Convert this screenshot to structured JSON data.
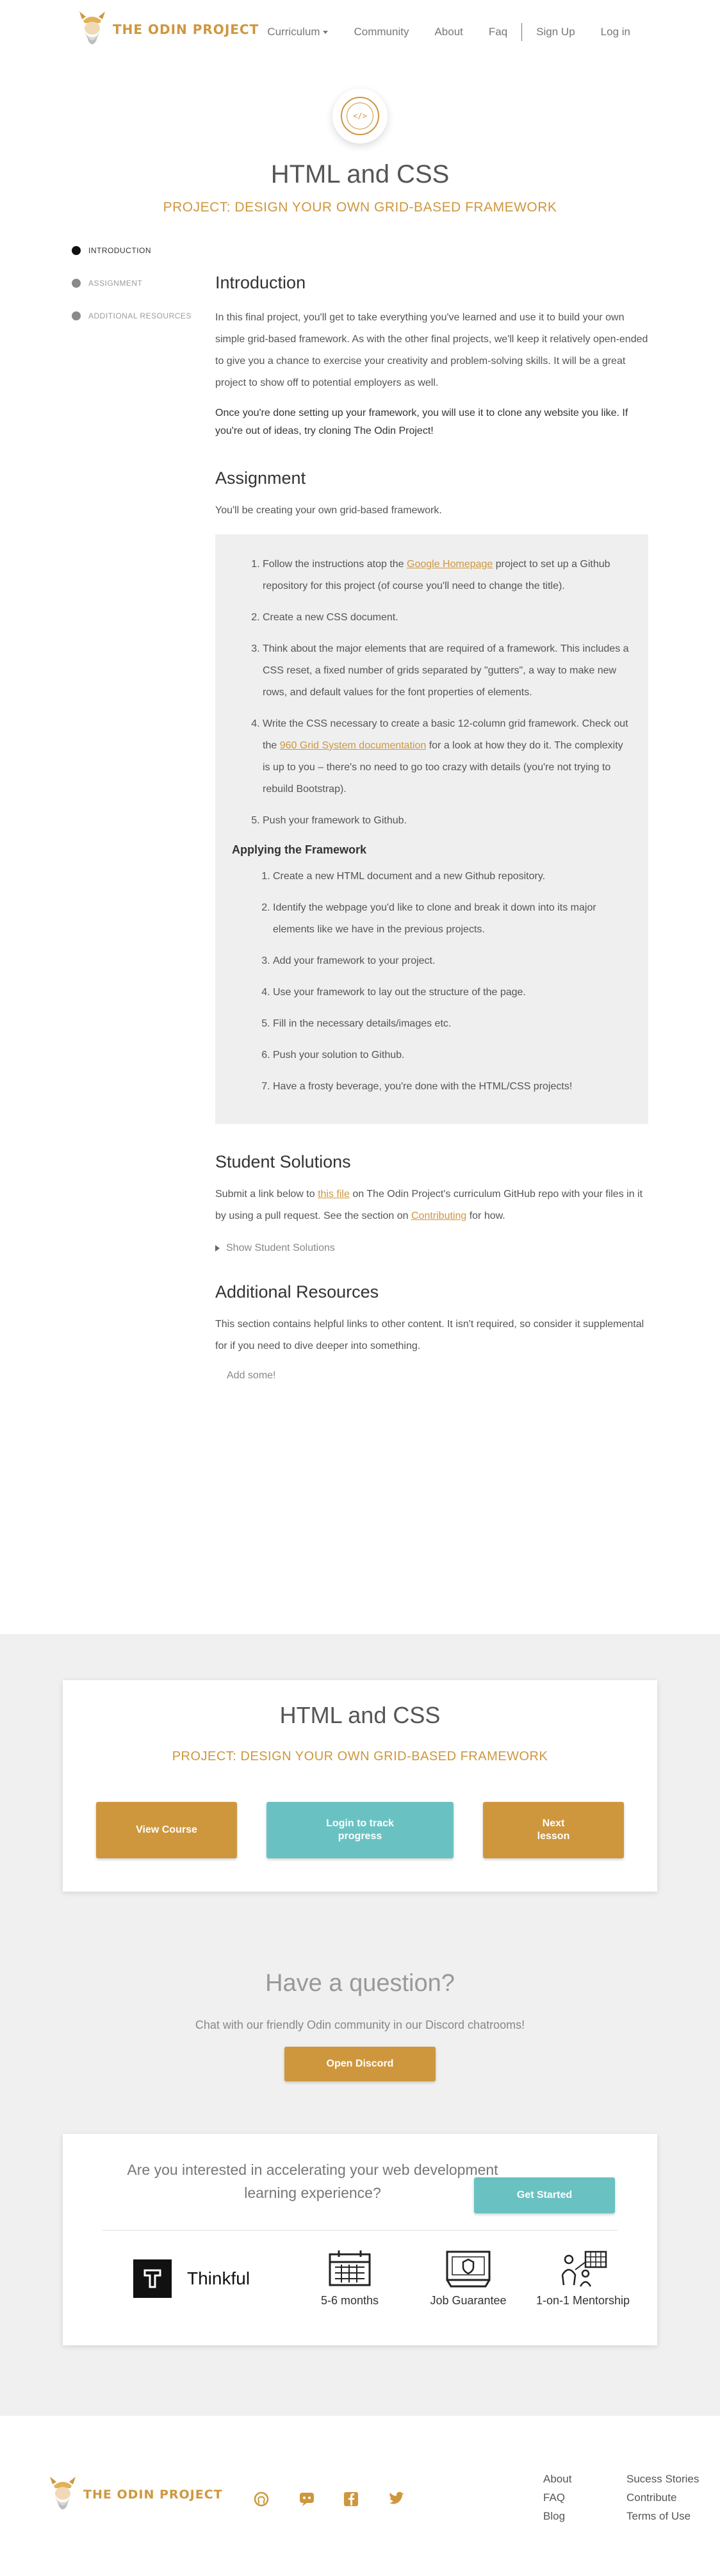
{
  "nav": {
    "brand": "THE ODIN PROJECT",
    "links": [
      "Curriculum",
      "Community",
      "About",
      "Faq",
      "Sign Up",
      "Log in"
    ]
  },
  "hero": {
    "title": "HTML and CSS",
    "subtitle": "PROJECT: DESIGN YOUR OWN GRID-BASED FRAMEWORK"
  },
  "toc": [
    "INTRODUCTION",
    "ASSIGNMENT",
    "ADDITIONAL RESOURCES"
  ],
  "intro": {
    "heading": "Introduction",
    "p1": "In this final project, you'll get to take everything you've learned and use it to build your own simple grid-based framework. As with the other final projects, we'll keep it relatively open-ended to give you a chance to exercise your creativity and problem-solving skills. It will be a great project to show off to potential employers as well.",
    "p2": "Once you're done setting up your framework, you will use it to clone any website you like. If you're out of ideas, try cloning The Odin Project!"
  },
  "assignment": {
    "heading": "Assignment",
    "lead": "You'll be creating your own grid-based framework.",
    "step1_pre": "Follow the instructions atop the ",
    "step1_link": "Google Homepage",
    "step1_post": " project to set up a Github repository for this project (of course you'll need to change the title).",
    "step2": "Create a new CSS document.",
    "step3": "Think about the major elements that are required of a framework. This includes a CSS reset, a fixed number of grids separated by \"gutters\", a way to make new rows, and default values for the font properties of elements.",
    "step4_pre": "Write the CSS necessary to create a basic 12-column grid framework. Check out the ",
    "step4_link": "960 Grid System documentation",
    "step4_post": " for a look at how they do it. The complexity is up to you – there's no need to go too crazy with details (you're not trying to rebuild Bootstrap).",
    "step5": "Push your framework to Github.",
    "applying_heading": "Applying the Framework",
    "applying": [
      "Create a new HTML document and a new Github repository.",
      "Identify the webpage you'd like to clone and break it down into its major elements like we have in the previous projects.",
      "Add your framework to your project.",
      "Use your framework to lay out the structure of the page.",
      "Fill in the necessary details/images etc.",
      "Push your solution to Github.",
      "Have a frosty beverage, you're done with the HTML/CSS projects!"
    ]
  },
  "solutions": {
    "heading": "Student Solutions",
    "p_pre": "Submit a link below to ",
    "p_link1": "this file",
    "p_mid": " on The Odin Project's curriculum GitHub repo with your files in it by using a pull request. See the section on ",
    "p_link2": "Contributing",
    "p_post": " for how.",
    "toggle": "Show Student Solutions"
  },
  "resources": {
    "heading": "Additional Resources",
    "p": "This section contains helpful links to other content. It isn't required, so consider it supplemental for if you need to dive deeper into something.",
    "add": "Add some!"
  },
  "lesson_card": {
    "title": "HTML and CSS",
    "subtitle": "PROJECT: DESIGN YOUR OWN GRID-BASED FRAMEWORK",
    "view": "View Course",
    "login": "Login to track progress",
    "next": "Next lesson"
  },
  "question": {
    "title": "Have a question?",
    "sub": "Chat with our friendly Odin community in our Discord chatrooms!",
    "button": "Open Discord"
  },
  "thinkful": {
    "ask": "Are you interested in accelerating your web development learning experience?",
    "button": "Get Started",
    "name": "Thinkful",
    "features": [
      "5-6 months",
      "Job Guarantee",
      "1-on-1 Mentorship"
    ]
  },
  "footer": {
    "brand": "THE ODIN PROJECT",
    "col1": [
      "About",
      "FAQ",
      "Blog"
    ],
    "col2": [
      "Sucess Stories",
      "Contribute",
      "Terms of Use"
    ]
  },
  "colors": {
    "accent": "#ce973e",
    "teal": "#6ac1c2"
  }
}
